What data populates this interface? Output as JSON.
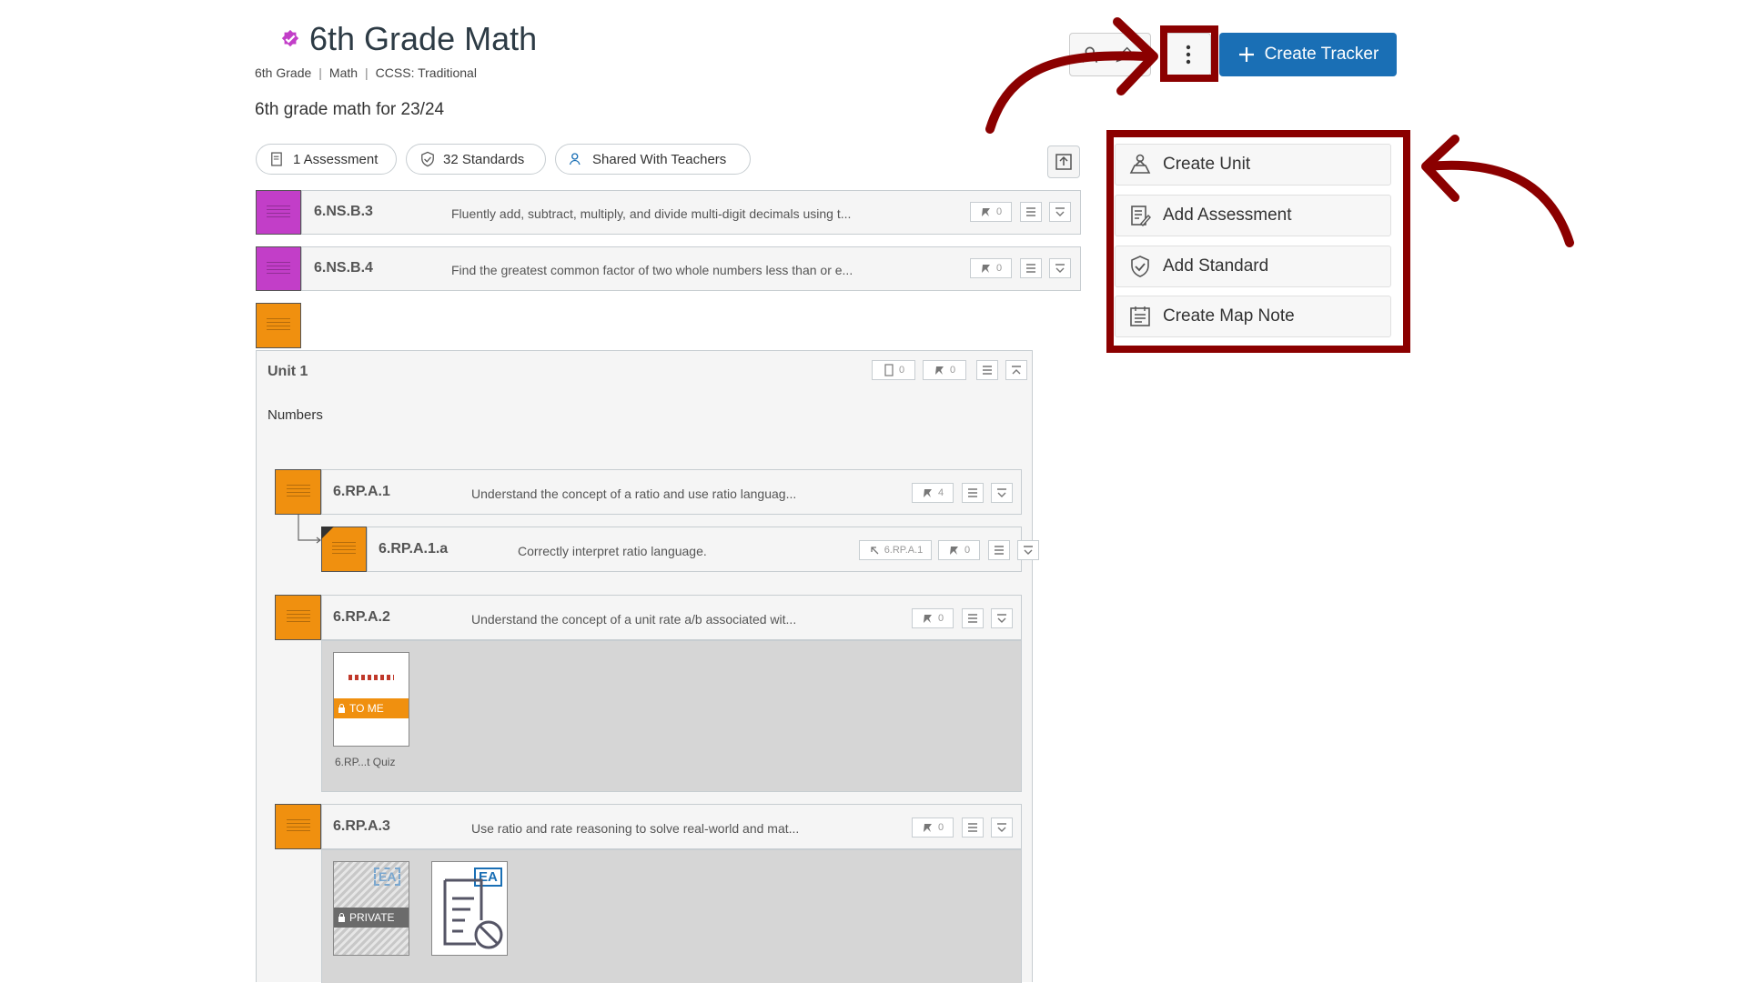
{
  "header": {
    "title": "6th Grade Math",
    "meta": [
      "6th Grade",
      "Math",
      "CCSS: Traditional"
    ],
    "meta_sep": "|",
    "description": "6th grade math for 23/24"
  },
  "toolbar": {
    "create_tracker_label": "Create Tracker",
    "more_icon": "kebab-vertical-icon"
  },
  "pills": [
    {
      "label": "1 Assessment",
      "icon": "assessment-icon"
    },
    {
      "label": "32 Standards",
      "icon": "shield-check-icon"
    },
    {
      "label": "Shared With Teachers",
      "icon": "people-icon"
    }
  ],
  "menu": {
    "items": [
      {
        "label": "Create Unit",
        "icon": "unit-icon"
      },
      {
        "label": "Add Assessment",
        "icon": "assessment-icon"
      },
      {
        "label": "Add Standard",
        "icon": "shield-check-icon"
      },
      {
        "label": "Create Map Note",
        "icon": "note-icon"
      }
    ]
  },
  "colors": {
    "magenta": "#c23ec8",
    "orange": "#f0900f",
    "accent_blue": "#1a6fb5",
    "annotation_red": "#8b0000"
  },
  "standards_top": [
    {
      "code": "6.NS.B.3",
      "text": "Fluently add, subtract, multiply, and divide multi-digit decimals using t...",
      "count": "0"
    },
    {
      "code": "6.NS.B.4",
      "text": "Find the greatest common factor of two whole numbers less than or e...",
      "count": "0"
    }
  ],
  "unit": {
    "title": "Unit 1",
    "subtitle": "Numbers",
    "doc_count": "0",
    "pin_count": "0"
  },
  "unit_standards": [
    {
      "code": "6.RP.A.1",
      "text": "Understand the concept of a ratio and use ratio languag...",
      "count": "4"
    },
    {
      "code": "6.RP.A.1.a",
      "text": "Correctly interpret ratio language.",
      "count": "0",
      "parent": "6.RP.A.1"
    },
    {
      "code": "6.RP.A.2",
      "text": "Understand the concept of a unit rate a/b associated wit...",
      "count": "0"
    },
    {
      "code": "6.RP.A.3",
      "text": "Use ratio and rate reasoning to solve real-world and mat...",
      "count": "0"
    }
  ],
  "assessments": {
    "quiz_badge": "TO ME",
    "quiz_caption": "6.RP...t Quiz",
    "private_badge": "PRIVATE",
    "ea_label": "EA"
  }
}
